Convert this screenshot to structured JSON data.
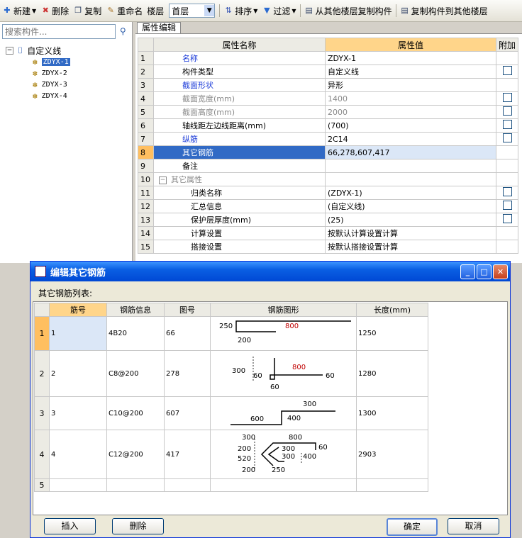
{
  "toolbar": {
    "new": "新建",
    "delete": "删除",
    "copy": "复制",
    "rename": "重命名",
    "floor_label": "楼层",
    "floor_value": "首层",
    "sort": "排序",
    "filter": "过滤",
    "copy_from": "从其他楼层复制构件",
    "copy_to": "复制构件到其他楼层"
  },
  "search": {
    "placeholder": "搜索构件..."
  },
  "tree": {
    "root": "自定义线",
    "children": [
      "ZDYX-1",
      "ZDYX-2",
      "ZDYX-3",
      "ZDYX-4"
    ],
    "selected": "ZDYX-1"
  },
  "props": {
    "tab": "属性编辑",
    "headers": {
      "name": "属性名称",
      "value": "属性值",
      "extra": "附加"
    },
    "rows": [
      {
        "n": "1",
        "name": "名称",
        "value": "ZDYX-1"
      },
      {
        "n": "2",
        "name": "构件类型",
        "value": "自定义线"
      },
      {
        "n": "3",
        "name": "截面形状",
        "value": "异形"
      },
      {
        "n": "4",
        "name": "截面宽度(mm)",
        "value": "1400"
      },
      {
        "n": "5",
        "name": "截面高度(mm)",
        "value": "2000"
      },
      {
        "n": "6",
        "name": "轴线距左边线距离(mm)",
        "value": "(700)"
      },
      {
        "n": "7",
        "name": "纵筋",
        "value": "2C14"
      },
      {
        "n": "8",
        "name": "其它钢筋",
        "value": "66,278,607,417"
      },
      {
        "n": "9",
        "name": "备注",
        "value": ""
      },
      {
        "n": "10",
        "name": "其它属性",
        "value": ""
      },
      {
        "n": "11",
        "name": "归类名称",
        "value": "(ZDYX-1)"
      },
      {
        "n": "12",
        "name": "汇总信息",
        "value": "(自定义线)"
      },
      {
        "n": "13",
        "name": "保护层厚度(mm)",
        "value": "(25)"
      },
      {
        "n": "14",
        "name": "计算设置",
        "value": "按默认计算设置计算"
      },
      {
        "n": "15",
        "name": "搭接设置",
        "value": "按默认搭接设置计算"
      }
    ]
  },
  "dialog": {
    "title": "编辑其它钢筋",
    "list_label": "其它钢筋列表:",
    "headers": {
      "no": "筋号",
      "info": "钢筋信息",
      "shape_no": "图号",
      "shape": "钢筋图形",
      "length": "长度(mm)"
    },
    "rows": [
      {
        "n": "1",
        "no": "1",
        "info": "4B20",
        "shape_no": "66",
        "length": "1250"
      },
      {
        "n": "2",
        "no": "2",
        "info": "C8@200",
        "shape_no": "278",
        "length": "1280"
      },
      {
        "n": "3",
        "no": "3",
        "info": "C10@200",
        "shape_no": "607",
        "length": "1300"
      },
      {
        "n": "4",
        "no": "4",
        "info": "C12@200",
        "shape_no": "417",
        "length": "2903"
      },
      {
        "n": "5",
        "no": "",
        "info": "",
        "shape_no": "",
        "length": ""
      }
    ],
    "shape_labels": {
      "s1": [
        "250",
        "800",
        "200"
      ],
      "s2": [
        "300",
        "60",
        "800",
        "60",
        "60"
      ],
      "s3": [
        "300",
        "600",
        "400"
      ],
      "s4": [
        "300",
        "800",
        "60",
        "200",
        "300",
        "520",
        "300",
        "400",
        "200",
        "250"
      ]
    },
    "buttons": {
      "insert": "插入",
      "delete": "删除",
      "ok": "确定",
      "cancel": "取消"
    }
  }
}
